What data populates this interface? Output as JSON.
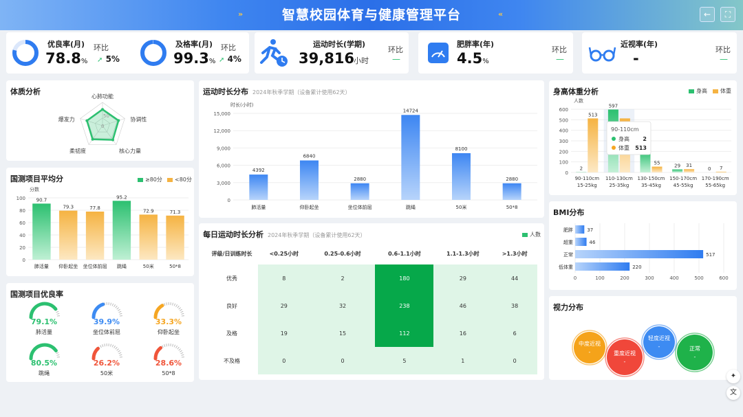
{
  "header": {
    "title": "智慧校园体育与健康管理平台",
    "back_icon": "←",
    "fullscreen_icon": "⛶",
    "left_deco": "»",
    "right_deco": "«"
  },
  "kpis": {
    "excellent": {
      "label": "优良率(月)",
      "value": "78.8",
      "unit": "%",
      "hb_label": "环比",
      "delta": "5%",
      "ring": 0.788
    },
    "pass": {
      "label": "及格率(月)",
      "value": "99.3",
      "unit": "%",
      "hb_label": "环比",
      "delta": "4%",
      "ring": 0.993
    },
    "duration": {
      "label": "运动时长(学期)",
      "value": "39,816",
      "unit": "小时",
      "hb_label": "环比",
      "delta": "—"
    },
    "obesity": {
      "label": "肥胖率(年)",
      "value": "4.5",
      "unit": "%",
      "hb_label": "环比",
      "delta": "—"
    },
    "myopia": {
      "label": "近视率(年)",
      "value": "-",
      "hb_label": "环比",
      "delta": "—"
    }
  },
  "physique": {
    "title": "体质分析",
    "axes": [
      "心肺功能",
      "协调性",
      "核心力量",
      "柔韧度",
      "爆发力"
    ],
    "ticks": [
      "0",
      "50"
    ],
    "values": [
      70,
      72,
      75,
      72,
      70
    ]
  },
  "avg_score": {
    "title": "国测项目平均分",
    "legend": [
      "≥80分",
      "<80分"
    ],
    "ylabel": "分数",
    "chart_data": {
      "type": "bar",
      "categories": [
        "肺活量",
        "仰卧起坐",
        "坐位体前屈",
        "跳绳",
        "50米",
        "50*8"
      ],
      "values": [
        90.7,
        79.3,
        77.8,
        95.2,
        72.9,
        71.3
      ],
      "value_labels": [
        "90.7",
        "79.3",
        "77.8",
        "95.2",
        "72.9",
        "71.3"
      ],
      "ylim": [
        0,
        100
      ],
      "yticks": [
        "0",
        "20",
        "40",
        "60",
        "80",
        "100"
      ]
    }
  },
  "excellent_rate": {
    "title": "国测项目优良率",
    "items": [
      {
        "name": "肺活量",
        "value": "79.1%",
        "rate": 0.791,
        "color": "#2cc070"
      },
      {
        "name": "坐位体前屈",
        "value": "39.9%",
        "rate": 0.399,
        "color": "#3d8bf2"
      },
      {
        "name": "仰卧起坐",
        "value": "33.3%",
        "rate": 0.333,
        "color": "#f5a623"
      },
      {
        "name": "跳绳",
        "value": "80.5%",
        "rate": 0.805,
        "color": "#2cc070"
      },
      {
        "name": "50米",
        "value": "26.2%",
        "rate": 0.262,
        "color": "#f0553a"
      },
      {
        "name": "50*8",
        "value": "28.6%",
        "rate": 0.286,
        "color": "#f0553a"
      }
    ]
  },
  "duration_dist": {
    "title": "运动时长分布",
    "subtitle": "2024年秋季学期（设备累计使用62天）",
    "ylabel": "时长(小时)",
    "chart_data": {
      "type": "bar",
      "categories": [
        "肺活量",
        "仰卧起坐",
        "坐位体前屈",
        "跳绳",
        "50米",
        "50*8"
      ],
      "values": [
        4392,
        6840,
        2880,
        14724,
        8100,
        2880
      ],
      "value_labels": [
        "4392",
        "6840",
        "2880",
        "14724",
        "8100",
        "2880"
      ],
      "ylim": [
        0,
        15000
      ],
      "yticks": [
        "0",
        "3,000",
        "6,000",
        "9,000",
        "12,000",
        "15,000"
      ]
    }
  },
  "daily": {
    "title": "每日运动时长分析",
    "subtitle": "2024年秋季学期（设备累计使用62天）",
    "legend": "人数",
    "corner": "评级/日训练时长",
    "columns": [
      "<0.25小时",
      "0.25-0.6小时",
      "0.6-1.1小时",
      "1.1-1.3小时",
      ">1.3小时"
    ],
    "rows": [
      {
        "label": "优秀",
        "cells": [
          "8",
          "2",
          "180",
          "29",
          "44"
        ]
      },
      {
        "label": "良好",
        "cells": [
          "29",
          "32",
          "238",
          "46",
          "38"
        ]
      },
      {
        "label": "及格",
        "cells": [
          "19",
          "15",
          "112",
          "16",
          "6"
        ]
      },
      {
        "label": "不及格",
        "cells": [
          "0",
          "0",
          "5",
          "1",
          "0"
        ]
      }
    ]
  },
  "height_weight": {
    "title": "身高体重分析",
    "legend": [
      "身高",
      "体重"
    ],
    "ylabel": "人数",
    "chart_data": {
      "type": "bar",
      "categories": [
        "90-110cm\n15-25kg",
        "110-130cm\n25-35kg",
        "130-150cm\n35-45kg",
        "150-170cm\n45-55kg",
        "170-190cm\n55-65kg"
      ],
      "series": [
        {
          "name": "身高",
          "values": [
            2,
            597,
            200,
            29,
            0
          ]
        },
        {
          "name": "体重",
          "values": [
            513,
            513,
            55,
            31,
            7
          ]
        }
      ],
      "value_labels": [
        [
          "2",
          "597",
          "",
          "29",
          "0"
        ],
        [
          "513",
          "",
          "55",
          "31",
          "7"
        ]
      ],
      "ylim": [
        0,
        600
      ],
      "yticks": [
        "0",
        "100",
        "200",
        "300",
        "400",
        "500",
        "600"
      ]
    },
    "tooltip": {
      "title": "90-110cm",
      "rows": [
        {
          "name": "身高",
          "value": "2"
        },
        {
          "name": "体重",
          "value": "513"
        }
      ]
    }
  },
  "bmi": {
    "title": "BMI分布",
    "chart_data": {
      "type": "bar",
      "categories": [
        "肥胖",
        "超重",
        "正常",
        "低体重"
      ],
      "values": [
        37,
        46,
        517,
        220
      ],
      "xlim": [
        0,
        600
      ],
      "xticks": [
        "0",
        "100",
        "200",
        "300",
        "400",
        "500",
        "600"
      ]
    }
  },
  "vision": {
    "title": "视力分布",
    "bubbles": [
      {
        "name": "中度近视",
        "value": "-",
        "color": "#f5a31a"
      },
      {
        "name": "重度近视",
        "value": "-",
        "color": "#f0473a"
      },
      {
        "name": "轻度近视",
        "value": "-",
        "color": "#3d8bf2"
      },
      {
        "name": "正常",
        "value": "-",
        "color": "#1fb24a"
      }
    ]
  },
  "fab": {
    "ai_icon": "✦",
    "translate_icon": "文"
  }
}
